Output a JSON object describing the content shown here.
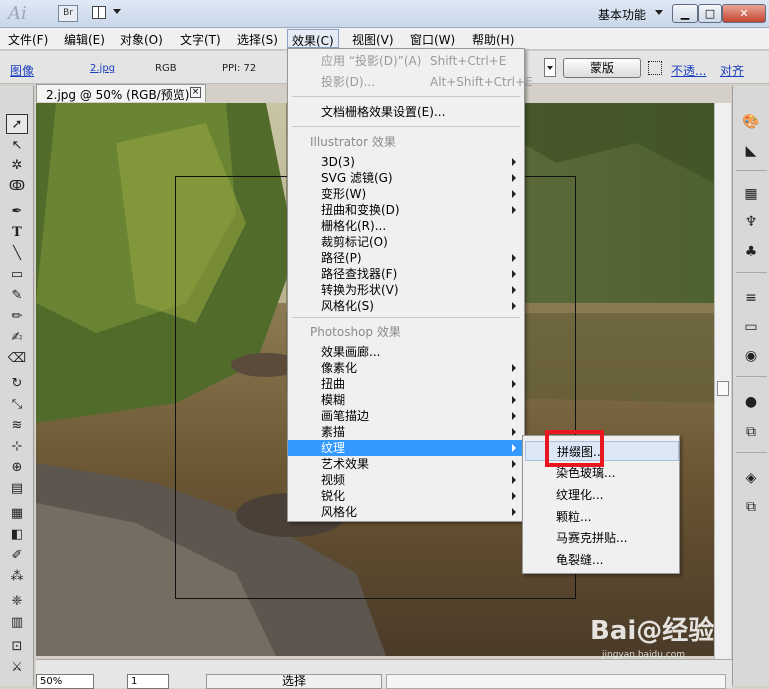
{
  "app": {
    "logo": "Ai",
    "bridge_label": "Br",
    "workspace": "基本功能"
  },
  "window_buttons": {
    "minimize": "▁",
    "maximize": "□",
    "close": "✕"
  },
  "menubar": [
    "文件(F)",
    "编辑(E)",
    "对象(O)",
    "文字(T)",
    "选择(S)",
    "效果(C)",
    "视图(V)",
    "窗口(W)",
    "帮助(H)"
  ],
  "controlbar": {
    "image_link": "图像",
    "file_link": "2.jpg",
    "color_mode": "RGB",
    "ppi": "PPI: 72",
    "mask_button": "蒙版",
    "opacity_link": "不透...",
    "align_link": "对齐"
  },
  "document": {
    "tab_title": "2.jpg @ 50% (RGB/预览)",
    "close": "×"
  },
  "statusbar": {
    "zoom": "50%",
    "page": "1",
    "tool": "选择"
  },
  "effect_menu": {
    "apply_last": {
      "label": "应用 “投影(D)”(A)",
      "shortcut": "Shift+Ctrl+E"
    },
    "last": {
      "label": "投影(D)...",
      "shortcut": "Alt+Shift+Ctrl+E"
    },
    "raster_settings": "文档栅格效果设置(E)...",
    "illustrator_section": "Illustrator 效果",
    "illustrator_items": [
      "3D(3)",
      "SVG 滤镜(G)",
      "变形(W)",
      "扭曲和变换(D)",
      "栅格化(R)...",
      "裁剪标记(O)",
      "路径(P)",
      "路径查找器(F)",
      "转换为形状(V)",
      "风格化(S)"
    ],
    "photoshop_section": "Photoshop 效果",
    "photoshop_items": [
      "效果画廊...",
      "像素化",
      "扭曲",
      "模糊",
      "画笔描边",
      "素描",
      "纹理",
      "艺术效果",
      "视频",
      "锐化",
      "风格化"
    ]
  },
  "texture_submenu": [
    "拼缀图...",
    "染色玻璃...",
    "纹理化...",
    "颗粒...",
    "马赛克拼贴...",
    "龟裂缝..."
  ],
  "watermark": {
    "text": "Bai@经验",
    "url": "jingyan.baidu.com"
  },
  "colors": {
    "highlight": "#3399ff",
    "callout": "#e8161e"
  }
}
